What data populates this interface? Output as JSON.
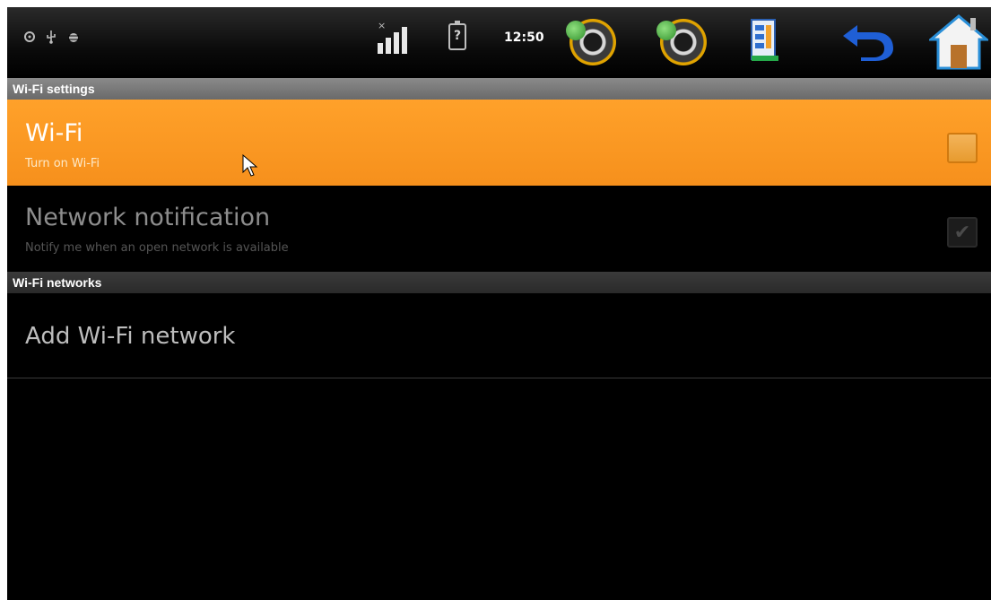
{
  "status_bar": {
    "icons_left": [
      "sync-icon",
      "usb-icon",
      "debug-icon"
    ],
    "signal_icon": "signal-icon",
    "battery_icon": "battery-unknown-icon",
    "battery_text": "?",
    "time": "12:50",
    "buttons": [
      "volume-down-icon",
      "volume-up-icon",
      "menu-icon",
      "back-icon",
      "home-icon"
    ]
  },
  "sections": {
    "settings_header": "Wi-Fi settings",
    "networks_header": "Wi-Fi networks"
  },
  "wifi": {
    "title": "Wi-Fi",
    "summary": "Turn on Wi-Fi",
    "checked": false
  },
  "notification": {
    "title": "Network notification",
    "summary": "Notify me when an open network is available",
    "checked": true,
    "check_glyph": "✔"
  },
  "add_network": {
    "title": "Add Wi-Fi network"
  },
  "colors": {
    "highlight": "#f6901c",
    "header": "#7a7a7a",
    "background": "#000000"
  }
}
